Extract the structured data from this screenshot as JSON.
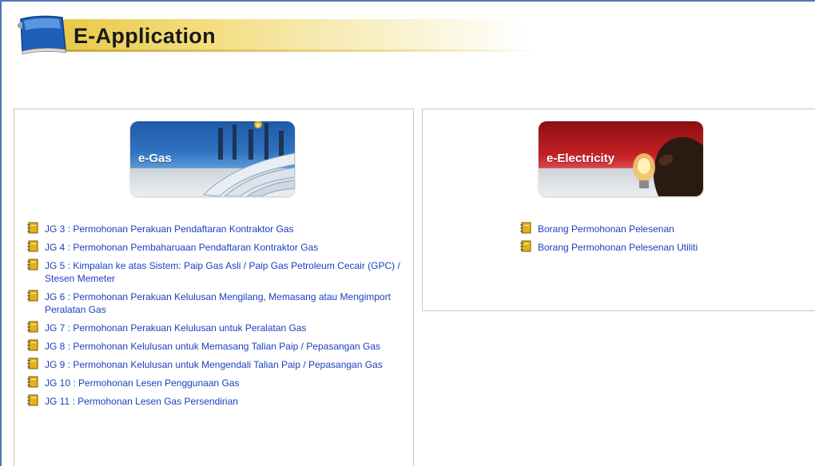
{
  "header": {
    "title": "E-Application"
  },
  "gas": {
    "banner_label": "e-Gas",
    "links": [
      "JG 3 : Permohonan Perakuan Pendaftaran Kontraktor Gas",
      "JG 4 : Permohonan Pembaharuaan Pendaftaran Kontraktor Gas",
      "JG 5 : Kimpalan ke atas Sistem: Paip Gas Asli / Paip Gas Petroleum Cecair (GPC) / Stesen Memeter",
      "JG 6 : Permohonan Perakuan Kelulusan Mengilang, Memasang atau Mengimport Peralatan Gas",
      "JG 7 : Permohonan Perakuan Kelulusan untuk Peralatan Gas",
      "JG 8 : Permohonan Kelulusan untuk Memasang Talian Paip / Pepasangan Gas",
      "JG 9 : Permohonan Kelulusan untuk Mengendali Talian Paip / Pepasangan Gas",
      "JG 10 : Permohonan Lesen Penggunaan Gas",
      "JG 11 : Permohonan Lesen Gas Persendirian"
    ]
  },
  "electricity": {
    "banner_label": "e-Electricity",
    "links": [
      "Borang Permohonan Pelesenan",
      "Borang Permohonan Pelesenan Utiliti"
    ]
  },
  "colors": {
    "link": "#1a3fbf",
    "frame": "#4a7ab5",
    "title_bar": "#e8c94a",
    "gas_banner": "#2f72c0",
    "elec_banner": "#c42025"
  },
  "icons": {
    "link_icon": "notebook-icon",
    "header_icon": "binder-icon"
  }
}
